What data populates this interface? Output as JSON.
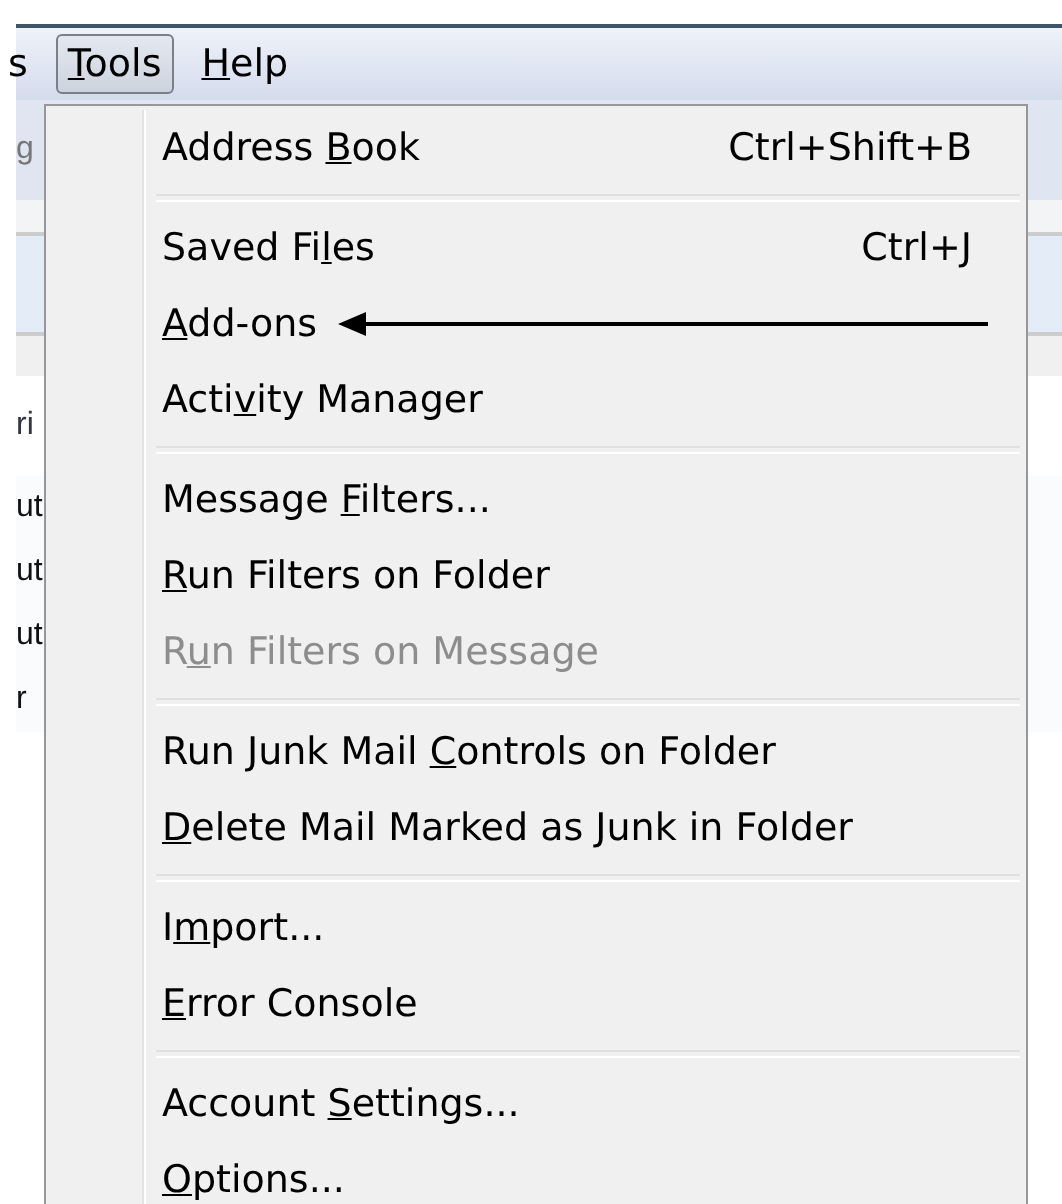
{
  "menubar": {
    "items": [
      {
        "before": "s",
        "selected": false
      },
      {
        "key": "T",
        "after": "ools",
        "selected": true
      },
      {
        "key": "H",
        "after": "elp",
        "selected": false
      }
    ]
  },
  "background": {
    "fragments": [
      {
        "text": "g",
        "kind": "toolbar"
      },
      {
        "text": "ri",
        "kind": "header"
      },
      {
        "text": "ut",
        "kind": "row"
      },
      {
        "text": "ut",
        "kind": "row"
      },
      {
        "text": "ut",
        "kind": "row"
      },
      {
        "text": "r",
        "kind": "row"
      }
    ]
  },
  "menu": {
    "groups": [
      [
        {
          "before": "Address ",
          "key": "B",
          "after": "ook",
          "shortcut": "Ctrl+Shift+B",
          "disabled": false,
          "arrow": false
        }
      ],
      [
        {
          "before": "Saved Fi",
          "key": "l",
          "after": "es",
          "shortcut": "Ctrl+J",
          "disabled": false,
          "arrow": false
        },
        {
          "key": "A",
          "after": "dd-ons",
          "disabled": false,
          "arrow": true
        },
        {
          "before": "Acti",
          "key": "v",
          "after": "ity Manager",
          "disabled": false,
          "arrow": false
        }
      ],
      [
        {
          "before": "Message ",
          "key": "F",
          "after": "ilters...",
          "disabled": false,
          "arrow": false
        },
        {
          "key": "R",
          "after": "un Filters on Folder",
          "disabled": false,
          "arrow": false
        },
        {
          "before": "R",
          "key": "u",
          "after": "n Filters on Message",
          "disabled": true,
          "arrow": false
        }
      ],
      [
        {
          "before": "Run Junk Mail ",
          "key": "C",
          "after": "ontrols on Folder",
          "disabled": false,
          "arrow": false
        },
        {
          "key": "D",
          "after": "elete Mail Marked as Junk in Folder",
          "disabled": false,
          "arrow": false
        }
      ],
      [
        {
          "before": "I",
          "key": "m",
          "after": "port...",
          "disabled": false,
          "arrow": false
        },
        {
          "key": "E",
          "after": "rror Console",
          "disabled": false,
          "arrow": false
        }
      ],
      [
        {
          "before": "Account ",
          "key": "S",
          "after": "ettings...",
          "disabled": false,
          "arrow": false
        },
        {
          "key": "O",
          "after": "ptions...",
          "disabled": false,
          "arrow": false
        }
      ]
    ]
  }
}
